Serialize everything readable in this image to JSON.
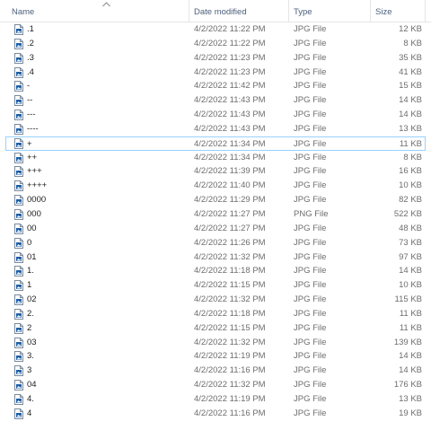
{
  "columns": {
    "name": "Name",
    "date": "Date modified",
    "type": "Type",
    "size": "Size"
  },
  "icons": {
    "sort": "chevron-up-icon",
    "file": "image-file-icon"
  },
  "colors": {
    "header_text": "#4c607a",
    "selection_border": "#99d1ff",
    "icon_blue": "#1d5fa8"
  },
  "files": [
    {
      "name": ".1",
      "date": "4/2/2022 11:22 PM",
      "type": "JPG File",
      "size": "12 KB"
    },
    {
      "name": ".2",
      "date": "4/2/2022 11:22 PM",
      "type": "JPG File",
      "size": "8 KB"
    },
    {
      "name": ".3",
      "date": "4/2/2022 11:23 PM",
      "type": "JPG File",
      "size": "35 KB"
    },
    {
      "name": ".4",
      "date": "4/2/2022 11:23 PM",
      "type": "JPG File",
      "size": "41 KB"
    },
    {
      "name": "-",
      "date": "4/2/2022 11:42 PM",
      "type": "JPG File",
      "size": "15 KB"
    },
    {
      "name": "--",
      "date": "4/2/2022 11:43 PM",
      "type": "JPG File",
      "size": "14 KB"
    },
    {
      "name": "---",
      "date": "4/2/2022 11:43 PM",
      "type": "JPG File",
      "size": "14 KB"
    },
    {
      "name": "----",
      "date": "4/2/2022 11:43 PM",
      "type": "JPG File",
      "size": "13 KB"
    },
    {
      "name": "+",
      "date": "4/2/2022 11:34 PM",
      "type": "JPG File",
      "size": "11 KB",
      "selected": true
    },
    {
      "name": "++",
      "date": "4/2/2022 11:34 PM",
      "type": "JPG File",
      "size": "8 KB"
    },
    {
      "name": "+++",
      "date": "4/2/2022 11:39 PM",
      "type": "JPG File",
      "size": "16 KB"
    },
    {
      "name": "++++",
      "date": "4/2/2022 11:40 PM",
      "type": "JPG File",
      "size": "10 KB"
    },
    {
      "name": "0000",
      "date": "4/2/2022 11:29 PM",
      "type": "JPG File",
      "size": "82 KB"
    },
    {
      "name": "000",
      "date": "4/2/2022 11:27 PM",
      "type": "PNG File",
      "size": "522 KB"
    },
    {
      "name": "00",
      "date": "4/2/2022 11:27 PM",
      "type": "JPG File",
      "size": "48 KB"
    },
    {
      "name": "0",
      "date": "4/2/2022 11:26 PM",
      "type": "JPG File",
      "size": "73 KB"
    },
    {
      "name": "01",
      "date": "4/2/2022 11:32 PM",
      "type": "JPG File",
      "size": "97 KB"
    },
    {
      "name": "1.",
      "date": "4/2/2022 11:18 PM",
      "type": "JPG File",
      "size": "14 KB"
    },
    {
      "name": "1",
      "date": "4/2/2022 11:15 PM",
      "type": "JPG File",
      "size": "10 KB"
    },
    {
      "name": "02",
      "date": "4/2/2022 11:32 PM",
      "type": "JPG File",
      "size": "115 KB"
    },
    {
      "name": "2.",
      "date": "4/2/2022 11:18 PM",
      "type": "JPG File",
      "size": "11 KB"
    },
    {
      "name": "2",
      "date": "4/2/2022 11:15 PM",
      "type": "JPG File",
      "size": "11 KB"
    },
    {
      "name": "03",
      "date": "4/2/2022 11:32 PM",
      "type": "JPG File",
      "size": "139 KB"
    },
    {
      "name": "3.",
      "date": "4/2/2022 11:19 PM",
      "type": "JPG File",
      "size": "14 KB"
    },
    {
      "name": "3",
      "date": "4/2/2022 11:16 PM",
      "type": "JPG File",
      "size": "14 KB"
    },
    {
      "name": "04",
      "date": "4/2/2022 11:32 PM",
      "type": "JPG File",
      "size": "176 KB"
    },
    {
      "name": "4.",
      "date": "4/2/2022 11:19 PM",
      "type": "JPG File",
      "size": "13 KB"
    },
    {
      "name": "4",
      "date": "4/2/2022 11:16 PM",
      "type": "JPG File",
      "size": "19 KB"
    }
  ]
}
